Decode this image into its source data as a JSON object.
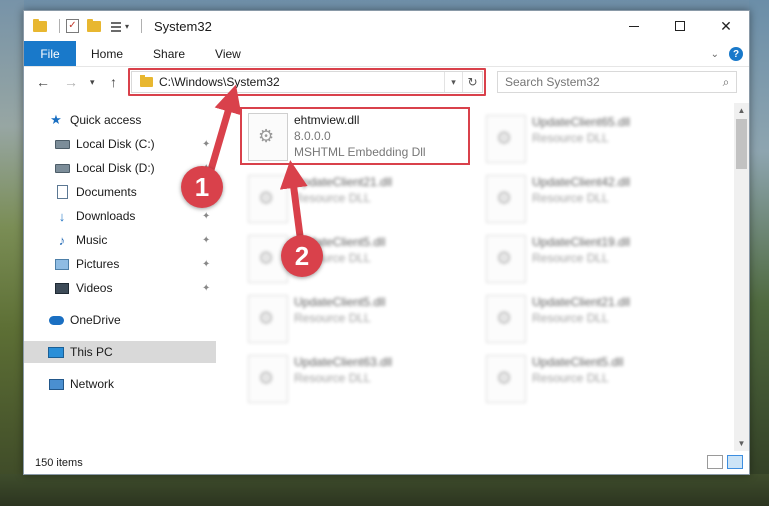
{
  "window": {
    "title": "System32"
  },
  "ribbon": {
    "tabs": [
      "File",
      "Home",
      "Share",
      "View"
    ],
    "help": "?"
  },
  "navigation": {
    "address": "C:\\Windows\\System32",
    "search_placeholder": "Search System32"
  },
  "sidebar": {
    "items": [
      {
        "label": "Quick access",
        "icon": "star-icon"
      },
      {
        "label": "Local Disk (C:)",
        "icon": "disk-icon",
        "pinned": true
      },
      {
        "label": "Local Disk (D:)",
        "icon": "disk-icon",
        "pinned": true
      },
      {
        "label": "Documents",
        "icon": "document-icon",
        "pinned": true
      },
      {
        "label": "Downloads",
        "icon": "download-icon",
        "pinned": true
      },
      {
        "label": "Music",
        "icon": "music-icon",
        "pinned": true
      },
      {
        "label": "Pictures",
        "icon": "pictures-icon",
        "pinned": true
      },
      {
        "label": "Videos",
        "icon": "videos-icon",
        "pinned": true
      },
      {
        "label": "OneDrive",
        "icon": "cloud-icon"
      },
      {
        "label": "This PC",
        "icon": "computer-icon",
        "selected": true
      },
      {
        "label": "Network",
        "icon": "network-icon"
      }
    ]
  },
  "files": {
    "highlighted": {
      "name": "ehtmview.dll",
      "version": "8.0.0.0",
      "description": "MSHTML Embedding Dll"
    },
    "column1": [
      {
        "name": "UpdateClient21.dll",
        "type": "Resource DLL"
      },
      {
        "name": "UpdateClient5.dll",
        "type": "Resource DLL"
      },
      {
        "name": "UpdateClient5.dll",
        "type": "Resource DLL"
      },
      {
        "name": "UpdateClient63.dll",
        "type": "Resource DLL"
      }
    ],
    "column2": [
      {
        "name": "UpdateClient65.dll",
        "type": "Resource DLL"
      },
      {
        "name": "UpdateClient42.dll",
        "type": "Resource DLL"
      },
      {
        "name": "UpdateClient19.dll",
        "type": "Resource DLL"
      },
      {
        "name": "UpdateClient21.dll",
        "type": "Resource DLL"
      },
      {
        "name": "UpdateClient5.dll",
        "type": "Resource DLL"
      }
    ]
  },
  "status": {
    "count": "150 items"
  },
  "annotations": {
    "step1": "1",
    "step2": "2",
    "color": "#d9414b"
  }
}
